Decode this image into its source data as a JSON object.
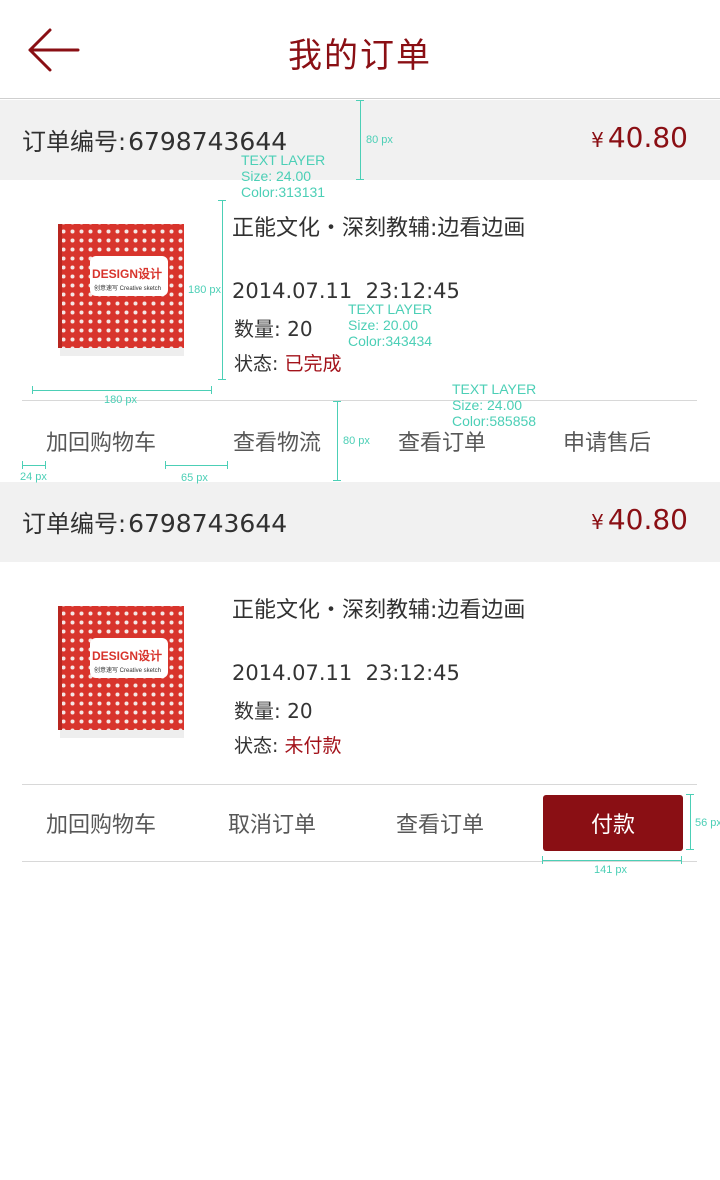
{
  "header": {
    "title": "我的订单",
    "back_icon": "arrow-left-icon"
  },
  "colors": {
    "accent": "#8a0f14",
    "text": "#313131",
    "secondary_text": "#585858",
    "order_header_bg": "#f1f1f1",
    "annotation": "#4ccfb6"
  },
  "orders": [
    {
      "order_label": "订单编号:",
      "order_number": "6798743644",
      "currency": "¥",
      "price": "40.80",
      "product_title": "正能文化・深刻教辅:边看边画",
      "datetime": "2014.07.11  23:12:45",
      "qty_label": "数量:",
      "qty": "20",
      "status_label": "状态:",
      "status": "已完成",
      "cover_text": "DESIGN设计",
      "cover_sub": "创意速写 Creative sketch",
      "actions": [
        "加回购物车",
        "查看物流",
        "查看订单",
        "申请售后"
      ]
    },
    {
      "order_label": "订单编号:",
      "order_number": "6798743644",
      "currency": "¥",
      "price": "40.80",
      "product_title": "正能文化・深刻教辅:边看边画",
      "datetime": "2014.07.11  23:12:45",
      "qty_label": "数量:",
      "qty": "20",
      "status_label": "状态:",
      "status": "未付款",
      "cover_text": "DESIGN设计",
      "cover_sub": "创意速写 Creative sketch",
      "actions": [
        "加回购物车",
        "取消订单",
        "查看订单"
      ],
      "pay_label": "付款"
    }
  ],
  "annotations": {
    "header_height": "80 px",
    "text_layer_1": "TEXT LAYER\nSize: 24.00\nColor:313131",
    "image_height": "180 px",
    "text_layer_2": "TEXT LAYER\nSize: 20.00\nColor:343434",
    "text_layer_3": "TEXT LAYER\nSize: 24.00\nColor:585858",
    "image_width": "180 px",
    "action_height": "80 px",
    "left_margin": "24 px",
    "action_gap": "65 px",
    "button_height": "56 px",
    "button_width": "141 px"
  }
}
